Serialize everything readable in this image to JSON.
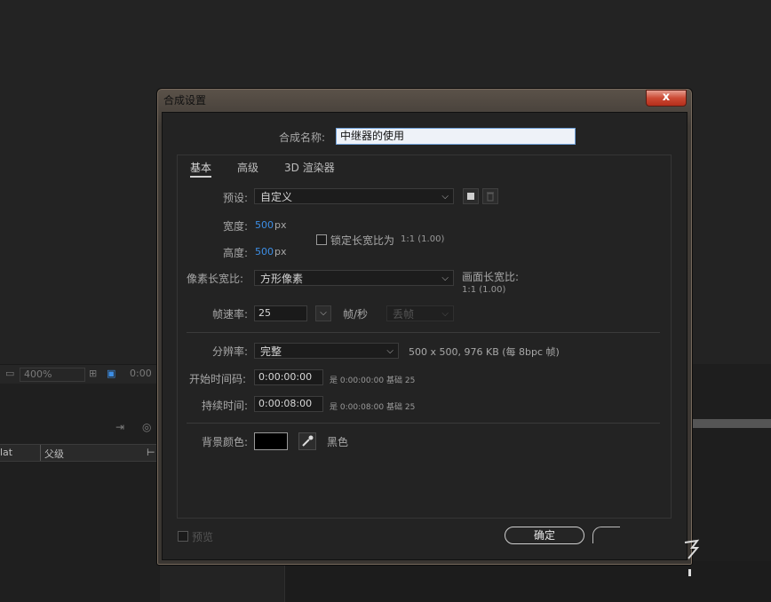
{
  "background": {
    "zoom": "400%",
    "timecode_partial": "0:00",
    "column_partial_1": "lat",
    "column_parent": "父级"
  },
  "dialog": {
    "title": "合成设置",
    "close_label": "x",
    "name_label": "合成名称:",
    "name_value": "中继器的使用",
    "tabs": [
      "基本",
      "高级",
      "3D 渲染器"
    ],
    "preset_label": "预设:",
    "preset_value": "自定义",
    "width_label": "宽度:",
    "width_value": "500",
    "height_label": "高度:",
    "height_value": "500",
    "unit_px": "px",
    "lock_aspect_label": "锁定长宽比为",
    "lock_aspect_value": "1:1 (1.00)",
    "pixel_aspect_label": "像素长宽比:",
    "pixel_aspect_value": "方形像素",
    "frame_aspect_label": "画面长宽比:",
    "frame_aspect_value": "1:1 (1.00)",
    "frame_rate_label": "帧速率:",
    "frame_rate_value": "25",
    "frame_rate_unit": "帧/秒",
    "drop_frame_value": "丢帧",
    "resolution_label": "分辨率:",
    "resolution_value": "完整",
    "resolution_info": "500 x 500, 976 KB (每 8bpc 帧)",
    "start_tc_label": "开始时间码:",
    "start_tc_value": "0:00:00:00",
    "start_tc_info": "是 0:00:00:00",
    "start_tc_base": "基础 25",
    "duration_label": "持续时间:",
    "duration_value": "0:00:08:00",
    "duration_info": "是 0:00:08:00",
    "duration_base": "基础 25",
    "bg_color_label": "背景颜色:",
    "bg_color_name": "黑色",
    "bg_color_hex": "#000000",
    "preview_label": "预览",
    "ok_label": "确定"
  }
}
